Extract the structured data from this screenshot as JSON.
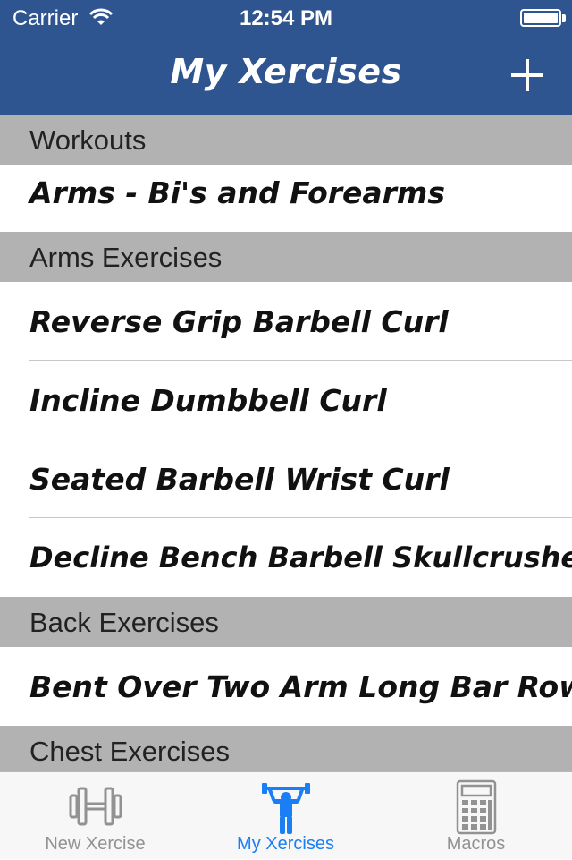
{
  "status_bar": {
    "carrier": "Carrier",
    "time": "12:54 PM"
  },
  "nav": {
    "title": "My Xercises",
    "add_icon": "plus-icon"
  },
  "sections": [
    {
      "header": "Workouts",
      "items": [
        "Arms - Bi's and Forearms"
      ]
    },
    {
      "header": "Arms Exercises",
      "items": [
        "Reverse Grip Barbell Curl",
        "Incline Dumbbell Curl",
        "Seated Barbell Wrist Curl",
        "Decline Bench Barbell Skullcrushers"
      ]
    },
    {
      "header": "Back Exercises",
      "items": [
        "Bent Over Two Arm Long Bar Row"
      ]
    },
    {
      "header": "Chest Exercises",
      "items": []
    }
  ],
  "tabs": [
    {
      "label": "New Xercise",
      "icon": "dumbbell-icon",
      "active": false
    },
    {
      "label": "My Xercises",
      "icon": "weightlifter-icon",
      "active": true
    },
    {
      "label": "Macros",
      "icon": "calculator-icon",
      "active": false
    }
  ],
  "colors": {
    "bar": "#2f5590",
    "section": "#b2b2b2",
    "tab_active": "#1a7ef5",
    "tab_inactive": "#929292"
  }
}
